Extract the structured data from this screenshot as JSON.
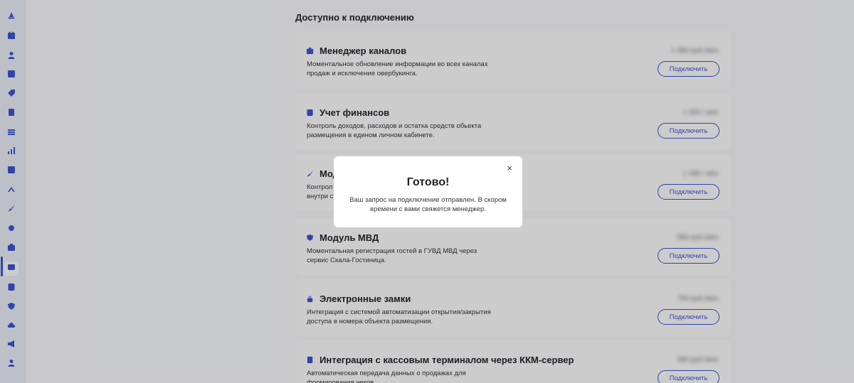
{
  "section": {
    "title": "Доступно к подключению"
  },
  "sidebar": {
    "items": [
      {
        "icon": "bell-icon"
      },
      {
        "icon": "calendar-icon"
      },
      {
        "icon": "user-icon"
      },
      {
        "icon": "chart-box-icon"
      },
      {
        "icon": "tag-icon"
      },
      {
        "icon": "clipboard-icon"
      },
      {
        "icon": "layers-icon"
      },
      {
        "icon": "bar-chart-icon"
      },
      {
        "icon": "check-box-icon"
      },
      {
        "icon": "hanger-icon"
      },
      {
        "icon": "broom-icon"
      },
      {
        "icon": "gear-icon"
      },
      {
        "icon": "briefcase-icon"
      },
      {
        "icon": "wallet-icon"
      },
      {
        "icon": "database-icon"
      },
      {
        "icon": "shield-icon"
      },
      {
        "icon": "cloud-icon"
      },
      {
        "icon": "megaphone-icon"
      },
      {
        "icon": "person-icon"
      }
    ]
  },
  "cards": [
    {
      "title": "Менеджер каналов",
      "desc": "Моментальное обновление информации во всех каналах продаж и исключение овербукинга.",
      "price": "1 990 руб./мес",
      "button": "Подключить",
      "icon": "briefcase-icon"
    },
    {
      "title": "Учет финансов",
      "desc": "Контроль доходов, расходов и остатка средств обьекта размещения в едином личном кабинете.",
      "price": "1 490 / мес",
      "button": "Подключить",
      "icon": "database-icon"
    },
    {
      "title": "Мод",
      "desc": "Контрол внутри с",
      "price": "1 490 / мес",
      "button": "Подключить",
      "icon": "broom-icon"
    },
    {
      "title": "Модуль МВД",
      "desc": "Моментальная регистрация гостей в ГУВД МВД через сервис Скала-Гостиница.",
      "price": "990 руб./мес",
      "button": "Подключить",
      "icon": "shield-icon"
    },
    {
      "title": "Электронные замки",
      "desc": "Интеграция с системой автоматизации открытия/закрытия доступа в номера объекта размещения.",
      "price": "790 руб./мес",
      "button": "Подключить",
      "icon": "lock-icon"
    },
    {
      "title": "Интеграция с кассовым терминалом через ККМ-сервер",
      "desc": "Автоматическая передача данных о продажах для формирования чеков.",
      "price": "590 руб./мес",
      "button": "Подключить",
      "icon": "receipt-icon"
    }
  ],
  "modal": {
    "title": "Готово!",
    "text": "Ваш запрос на подключение отправлен. В скором времени с вами свяжется менеджер.",
    "close": "×"
  }
}
